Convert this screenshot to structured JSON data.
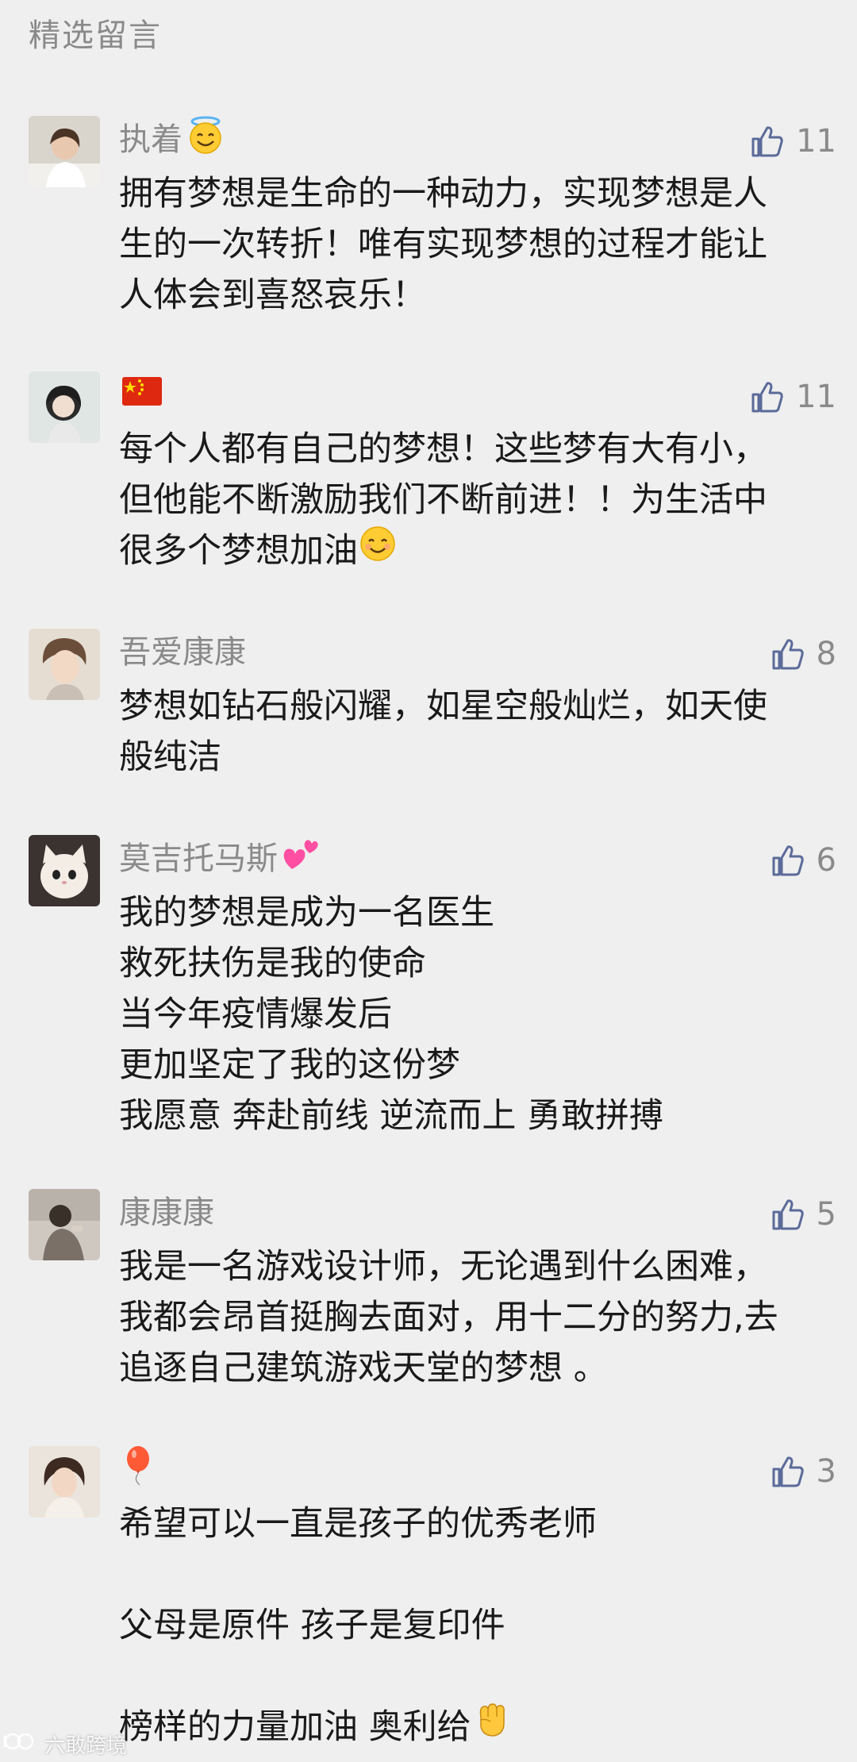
{
  "section_title": "精选留言",
  "colors": {
    "background": "#efefef",
    "muted_text": "#8a8a8a",
    "body_text": "#1a1a1a",
    "like_icon": "#5b6b99"
  },
  "comments": [
    {
      "nickname": "执着",
      "nickname_emoji": "smiling-face-with-halo",
      "like_count": "11",
      "lines": [
        "拥有梦想是生命的一种动力，实现梦想是人",
        "生的一次转折！唯有实现梦想的过程才能让",
        "人体会到喜怒哀乐！"
      ]
    },
    {
      "nickname": "",
      "nickname_emoji": "china-flag",
      "like_count": "11",
      "lines": [
        "每个人都有自己的梦想！这些梦有大有小，",
        "但他能不断激励我们不断前进！！为生活中",
        "很多个梦想加油"
      ]
    },
    {
      "nickname": "吾爱康康",
      "nickname_emoji": "",
      "like_count": "8",
      "lines": [
        "梦想如钻石般闪耀，如星空般灿烂，如天使",
        "般纯洁"
      ]
    },
    {
      "nickname": "莫吉托马斯",
      "nickname_emoji": "two-hearts",
      "like_count": "6",
      "lines": [
        "我的梦想是成为一名医生",
        "救死扶伤是我的使命",
        "当今年疫情爆发后",
        "更加坚定了我的这份梦",
        "我愿意 奔赴前线 逆流而上 勇敢拼搏"
      ]
    },
    {
      "nickname": "康康康",
      "nickname_emoji": "",
      "like_count": "5",
      "lines": [
        "我是一名游戏设计师，无论遇到什么困难，",
        "我都会昂首挺胸去面对，用十二分的努力,去",
        "追逐自己建筑游戏天堂的梦想 。"
      ]
    },
    {
      "nickname": "",
      "nickname_emoji": "balloon",
      "like_count": "3",
      "lines": [
        "希望可以一直是孩子的优秀老师",
        "",
        "父母是原件 孩子是复印件",
        "",
        "榜样的力量加油 奥利给"
      ]
    }
  ],
  "watermark": {
    "text": "六敢跨境"
  },
  "comment2_trailing_emoji": "smiling-face",
  "comment6_trailing_emoji": "raised-fist"
}
